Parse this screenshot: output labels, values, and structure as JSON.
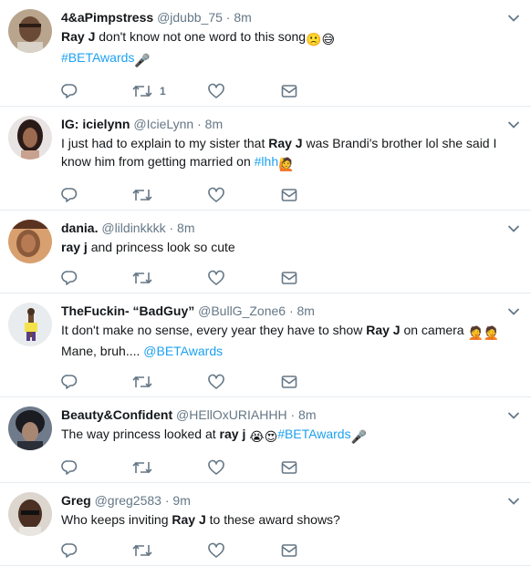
{
  "tweets": [
    {
      "name": "4&aPimpstress",
      "handle": "@jdubb_75",
      "time": "8m",
      "parts": [
        {
          "t": "b",
          "v": "Ray J"
        },
        {
          "t": "n",
          "v": " don't know not one word to this song"
        },
        {
          "t": "e",
          "v": "🙁😅"
        },
        {
          "t": "br"
        },
        {
          "t": "h",
          "v": "#BETAwards"
        },
        {
          "t": "e",
          "v": " 🎤"
        }
      ],
      "retweets": "1",
      "avatar": "av1"
    },
    {
      "name": "IG: icielynn",
      "handle": "@IcieLynn",
      "time": "8m",
      "parts": [
        {
          "t": "n",
          "v": "I just had to explain to my sister that "
        },
        {
          "t": "b",
          "v": "Ray J"
        },
        {
          "t": "n",
          "v": " was Brandi's brother lol she said I know him from getting married on "
        },
        {
          "t": "h",
          "v": "#lhh"
        },
        {
          "t": "e",
          "v": " 🙋"
        }
      ],
      "retweets": "",
      "avatar": "av2"
    },
    {
      "name": "dania.",
      "handle": "@lildinkkkk",
      "time": "8m",
      "parts": [
        {
          "t": "b",
          "v": "ray j"
        },
        {
          "t": "n",
          "v": " and princess look so cute"
        }
      ],
      "retweets": "",
      "avatar": "av3"
    },
    {
      "name": "TheFuckin- “BadGuy”",
      "handle": "@BullG_Zone6",
      "time": "8m",
      "parts": [
        {
          "t": "n",
          "v": "It don't make no sense, every year they have to show "
        },
        {
          "t": "b",
          "v": "Ray J"
        },
        {
          "t": "n",
          "v": " on camera "
        },
        {
          "t": "e",
          "v": "🤦🤦"
        },
        {
          "t": "br"
        },
        {
          "t": "n",
          "v": "Mane, bruh.... "
        },
        {
          "t": "h",
          "v": "@BETAwards"
        }
      ],
      "retweets": "",
      "avatar": "av4"
    },
    {
      "name": "Beauty&Confident",
      "handle": "@HEllOxURIAHHH",
      "time": "8m",
      "parts": [
        {
          "t": "n",
          "v": "The way princess looked at "
        },
        {
          "t": "b",
          "v": "ray j"
        },
        {
          "t": "n",
          "v": " "
        },
        {
          "t": "e",
          "v": "😭😍"
        },
        {
          "t": "h",
          "v": "#BETAwards"
        },
        {
          "t": "e",
          "v": " 🎤"
        }
      ],
      "retweets": "",
      "avatar": "av5"
    },
    {
      "name": "Greg",
      "handle": "@greg2583",
      "time": "9m",
      "parts": [
        {
          "t": "n",
          "v": "Who keeps inviting "
        },
        {
          "t": "b",
          "v": "Ray J"
        },
        {
          "t": "n",
          "v": " to these award shows?"
        }
      ],
      "retweets": "",
      "avatar": "av6"
    }
  ],
  "icons": {
    "reply": "reply-icon",
    "retweet": "retweet-icon",
    "like": "heart-icon",
    "dm": "envelope-icon",
    "caret": "chevron-down-icon"
  },
  "colors": {
    "link": "#1da1f2",
    "muted": "#657786",
    "icon": "#657786",
    "divider": "#e6ecf0"
  }
}
